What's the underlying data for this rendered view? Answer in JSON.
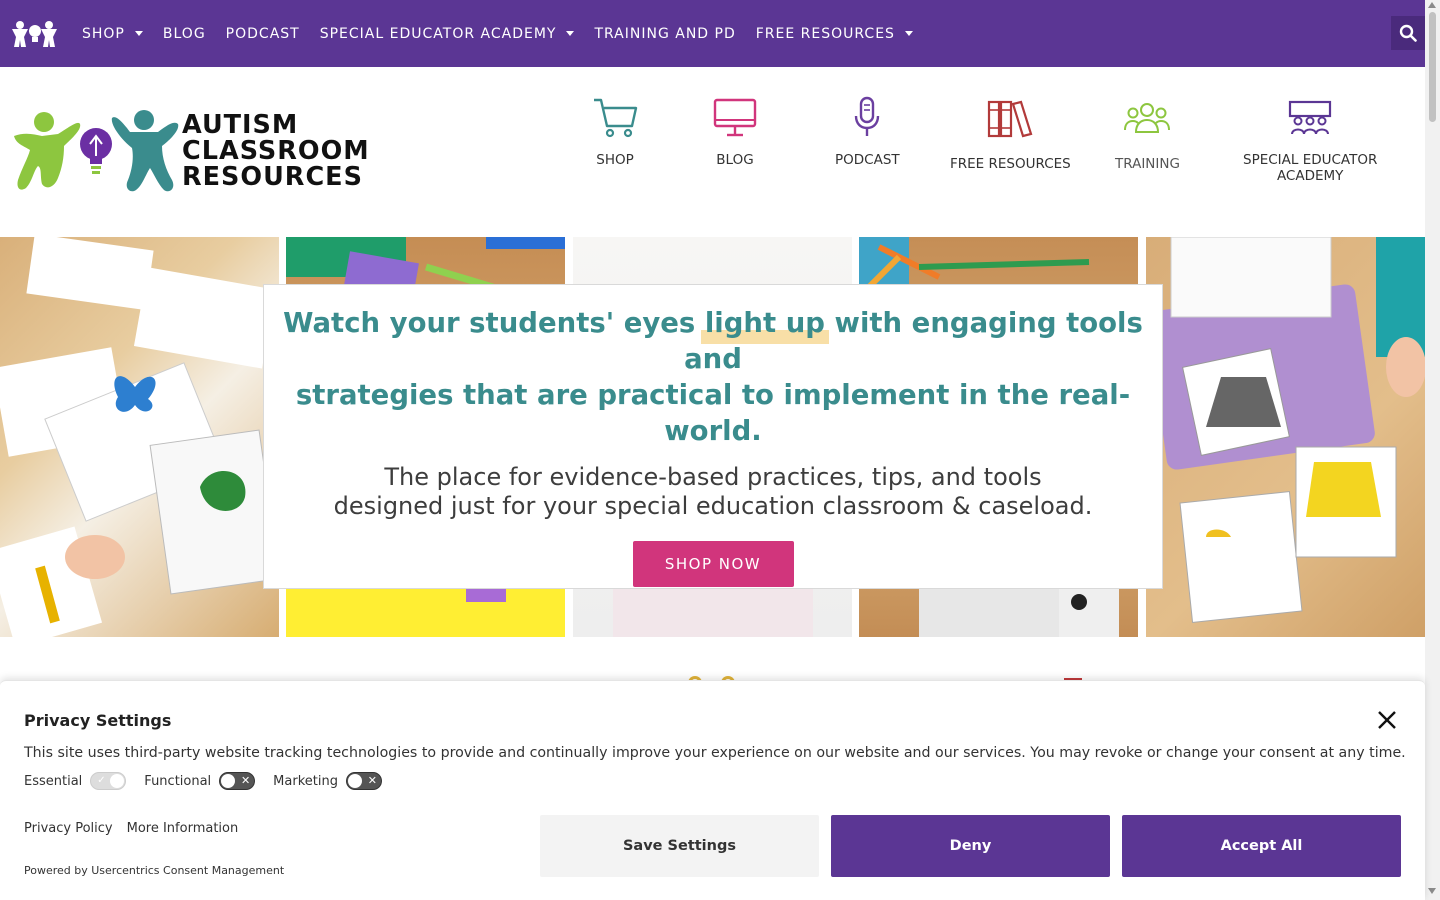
{
  "topnav": {
    "items": [
      {
        "label": "SHOP",
        "dropdown": true
      },
      {
        "label": "BLOG",
        "dropdown": false
      },
      {
        "label": "PODCAST",
        "dropdown": false
      },
      {
        "label": "SPECIAL EDUCATOR ACADEMY",
        "dropdown": true
      },
      {
        "label": "TRAINING AND PD",
        "dropdown": false
      },
      {
        "label": "FREE RESOURCES",
        "dropdown": true
      }
    ],
    "background": "#5b3694"
  },
  "brand": {
    "line1": "AUTISM",
    "line2": "CLASSROOM",
    "line3": "RESOURCES"
  },
  "icon_nav": {
    "shop": "SHOP",
    "blog": "BLOG",
    "podcast": "PODCAST",
    "free_resources": "FREE RESOURCES",
    "training": "TRAINING",
    "academy_line1": "SPECIAL EDUCATOR",
    "academy_line2": "ACADEMY"
  },
  "hero": {
    "title_part1": "Watch your students' eyes ",
    "title_highlight": "light up",
    "title_part2": " with engaging tools and",
    "title_line2": "strategies that are practical to implement in the real-world.",
    "sub_line1": "The place for evidence-based practices, tips, and tools",
    "sub_line2": "designed just for your special education classroom & caseload.",
    "cta": "SHOP NOW"
  },
  "privacy": {
    "title": "Privacy Settings",
    "description": "This site uses third-party website tracking technologies to provide and continually improve your experience on our website and our services. You may revoke or change your consent at any time.",
    "toggles": [
      {
        "label": "Essential",
        "state": "on-locked"
      },
      {
        "label": "Functional",
        "state": "off"
      },
      {
        "label": "Marketing",
        "state": "off"
      }
    ],
    "links": [
      "Privacy Policy",
      "More Information"
    ],
    "powered_by": "Powered by Usercentrics Consent Management",
    "buttons": {
      "save": "Save Settings",
      "deny": "Deny",
      "accept": "Accept All"
    }
  },
  "colors": {
    "purple": "#5b3694",
    "teal": "#3a8c8d",
    "pink": "#d1357c",
    "highlight": "#f5d489"
  }
}
